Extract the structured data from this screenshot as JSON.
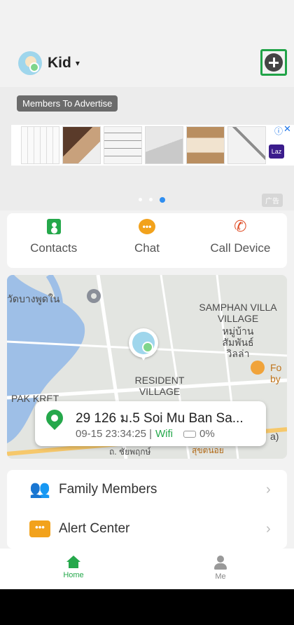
{
  "header": {
    "kid_name": "Kid",
    "caret": "▾"
  },
  "ad": {
    "tag": "Members To Advertise",
    "info_glyph": "ⓘ",
    "close_glyph": "✕",
    "brand": "Laz",
    "label": "广告",
    "carousel_active_index": 2,
    "carousel_count": 3
  },
  "actions": {
    "contacts": "Contacts",
    "chat": "Chat",
    "call_device": "Call Device"
  },
  "map": {
    "labels": {
      "thai_top_left": "วัดบางพูดใน",
      "samphan_en": "SAMPHAN VILLA VILLAGE",
      "samphan_th": "หมู่บ้าน สัมพันธ์ วิลล่า",
      "resident": "RESIDENT VILLAGE",
      "pak_kret": "PAK KRET",
      "right_partial_1": "Fo",
      "right_partial_2": "by",
      "right_partial_3": "a)",
      "bottom_road_1": "ถ. ชัยพฤกษ์",
      "bottom_road_2": "สุขตนอย"
    },
    "location": {
      "address": "29 126 ม.5 Soi Mu Ban Sa...",
      "timestamp": "09-15 23:34:25 |",
      "network": "Wifi",
      "battery": "0%"
    }
  },
  "menu": {
    "family_members": "Family Members",
    "alert_center": "Alert Center",
    "chevron": "›"
  },
  "tabbar": {
    "home": "Home",
    "me": "Me"
  },
  "colors": {
    "brand_green": "#25a84b",
    "chat_orange": "#f2a21c",
    "call_red": "#e0512b",
    "carousel_active": "#2f8ef0"
  }
}
